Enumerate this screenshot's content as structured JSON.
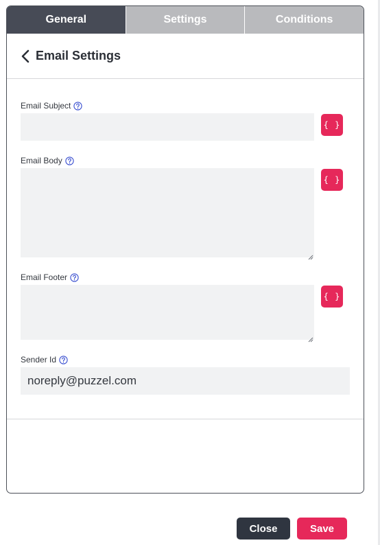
{
  "tabs": [
    {
      "label": "General",
      "active": true
    },
    {
      "label": "Settings",
      "active": false
    },
    {
      "label": "Conditions",
      "active": false
    }
  ],
  "header": {
    "title": "Email Settings",
    "back_icon": "chevron-left-icon"
  },
  "fields": {
    "subject": {
      "label": "Email Subject",
      "value": "",
      "help_icon": "question-circle-icon"
    },
    "body": {
      "label": "Email Body",
      "value": "",
      "help_icon": "question-circle-icon"
    },
    "footer": {
      "label": "Email Footer",
      "value": "",
      "help_icon": "question-circle-icon"
    },
    "sender": {
      "label": "Sender Id",
      "value": "noreply@puzzel.com",
      "help_icon": "question-circle-icon"
    }
  },
  "variable_button_label": "{ }",
  "actions": {
    "close_label": "Close",
    "save_label": "Save"
  },
  "colors": {
    "accent": "#e6285a",
    "tab_active": "#474b56",
    "tab_inactive": "#b9babd",
    "close_button": "#2f3540",
    "help_icon": "#3a4fd0"
  }
}
